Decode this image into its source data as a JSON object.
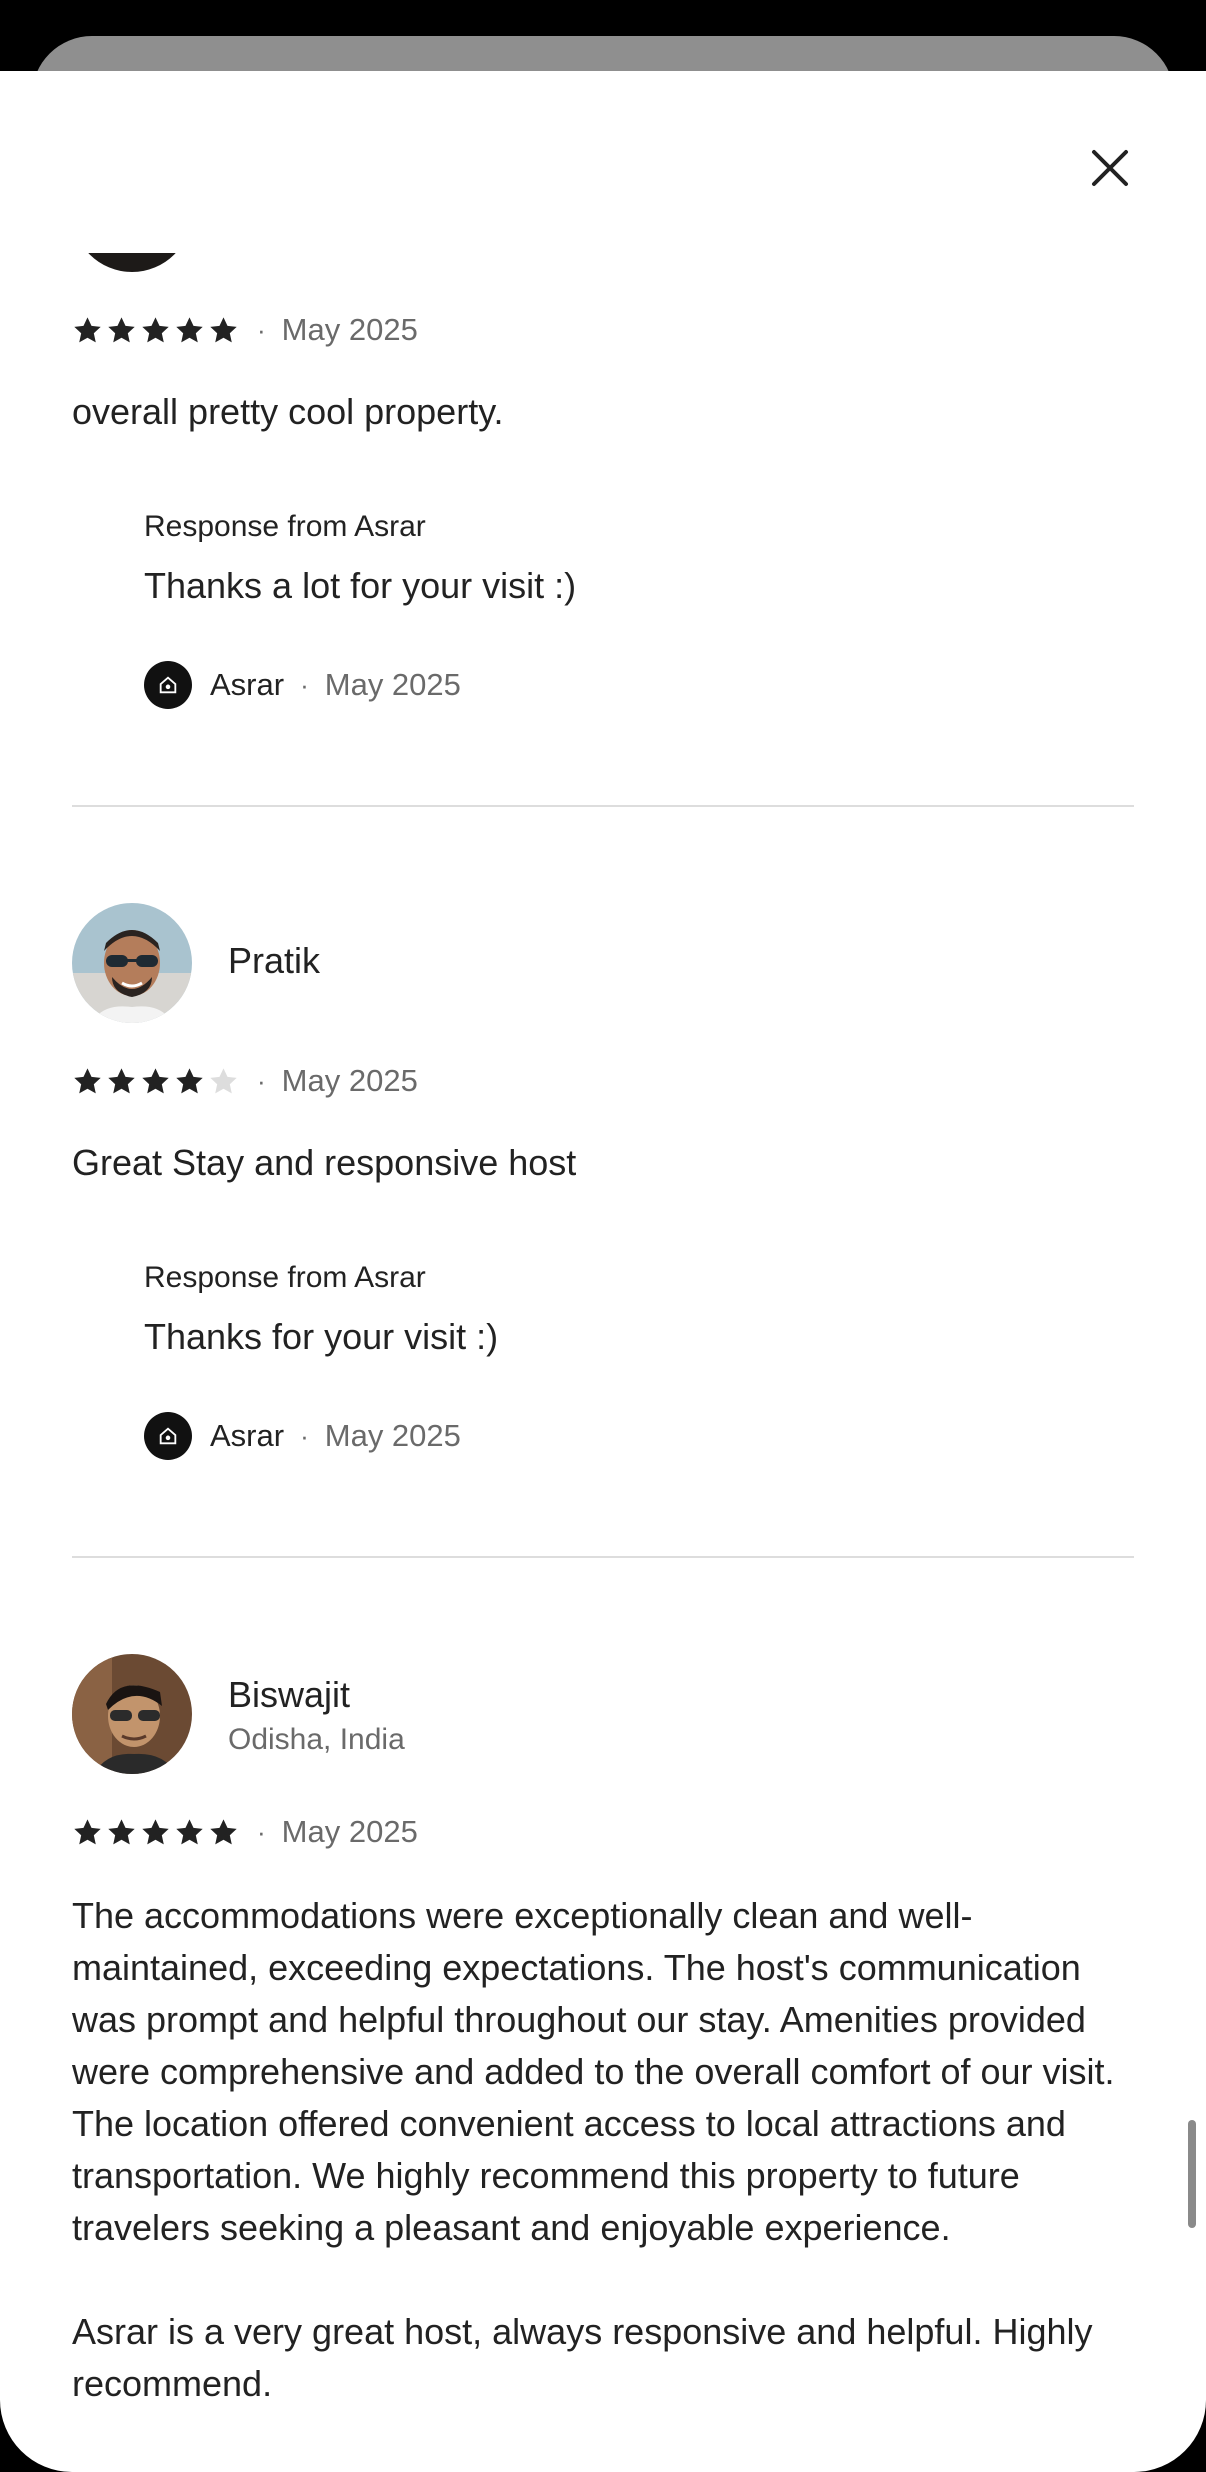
{
  "dialog": {
    "close_label": "Close"
  },
  "reviews": [
    {
      "date": "May 2025",
      "rating": 5,
      "text": "overall pretty cool property.",
      "response": {
        "heading": "Response from Asrar",
        "text": "Thanks a lot for your visit :)",
        "host_name": "Asrar",
        "date": "May 2025"
      }
    },
    {
      "name": "Pratik",
      "date": "May 2025",
      "rating": 4,
      "text": "Great Stay and responsive host",
      "response": {
        "heading": "Response from Asrar",
        "text": "Thanks for your visit :)",
        "host_name": "Asrar",
        "date": "May 2025"
      }
    },
    {
      "name": "Biswajit",
      "location": "Odisha, India",
      "date": "May 2025",
      "rating": 5,
      "text_paragraph_1": "The accommodations were exceptionally clean and well-maintained, exceeding expectations.  The host's communication was prompt and helpful throughout our stay.  Amenities provided were comprehensive and added to the overall comfort of our visit.  The location offered convenient access to local attractions and transportation.  We highly recommend this property to future travelers seeking a pleasant and enjoyable experience.",
      "text_paragraph_2": "Asrar is a very great host, always responsive and helpful. Highly recommend."
    }
  ],
  "separator": "·",
  "colors": {
    "text_primary": "#222222",
    "text_secondary": "#6a6a6a",
    "star_filled": "#222222",
    "star_empty": "#dddddd",
    "divider": "#dddddd"
  }
}
